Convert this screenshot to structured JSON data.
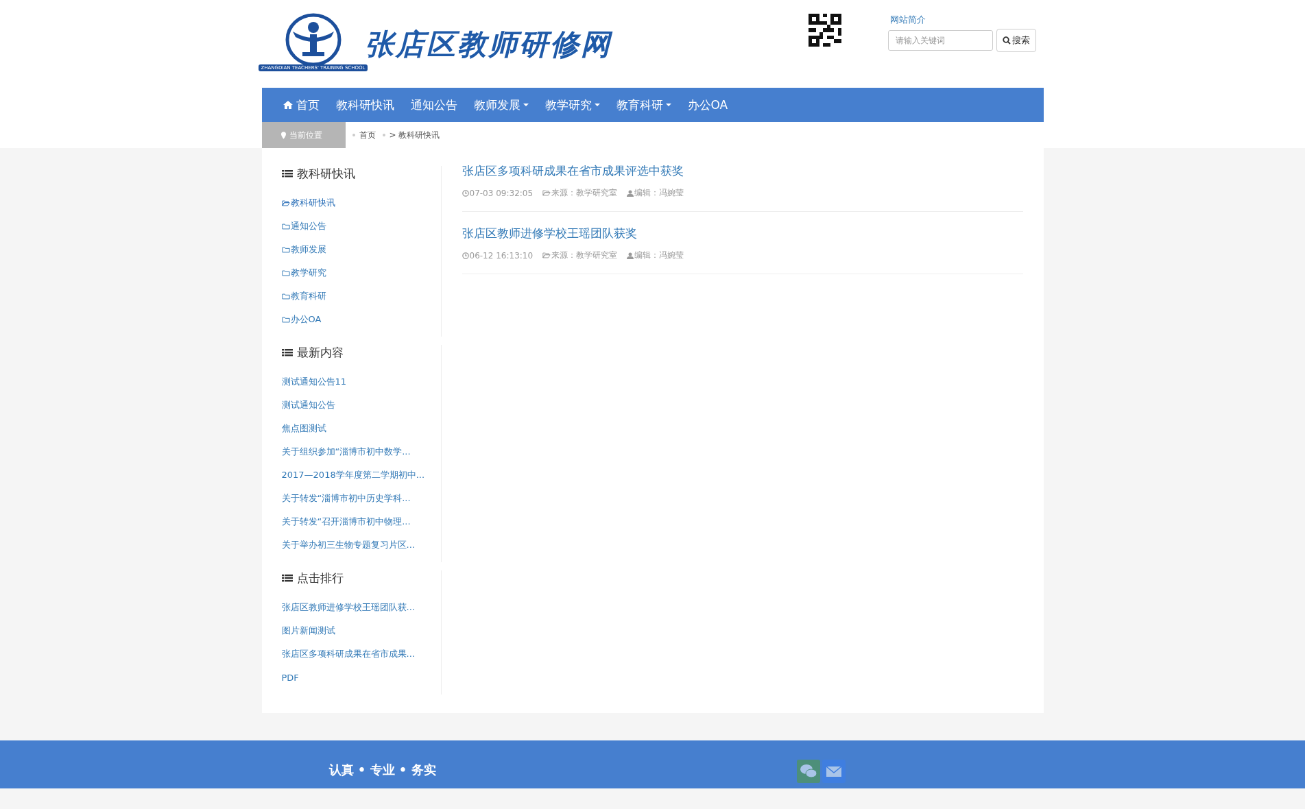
{
  "header": {
    "site_title": "张店区教师研修网",
    "emblem_caption": "ZHANGDIAN TEACHERS' TRAINING SCHOOL",
    "about_link": "网站简介",
    "search": {
      "placeholder": "请输入关键词",
      "button": "搜索"
    }
  },
  "nav": [
    {
      "label": "首页",
      "kind": "home",
      "dropdown": false
    },
    {
      "label": "教科研快讯",
      "kind": "link",
      "dropdown": false
    },
    {
      "label": "通知公告",
      "kind": "link",
      "dropdown": false
    },
    {
      "label": "教师发展",
      "kind": "link",
      "dropdown": true
    },
    {
      "label": "教学研究",
      "kind": "link",
      "dropdown": true
    },
    {
      "label": "教育科研",
      "kind": "link",
      "dropdown": true
    },
    {
      "label": "办公OA",
      "kind": "link",
      "dropdown": false
    }
  ],
  "breadcrumb": {
    "label": "当前位置",
    "items": [
      "首页",
      "> 教科研快讯"
    ]
  },
  "sidebar": [
    {
      "title": "教科研快讯",
      "kind": "category",
      "items": [
        {
          "label": "教科研快讯",
          "selected": true
        },
        {
          "label": "通知公告",
          "selected": false
        },
        {
          "label": "教师发展",
          "selected": false
        },
        {
          "label": "教学研究",
          "selected": false
        },
        {
          "label": "教育科研",
          "selected": false
        },
        {
          "label": "办公OA",
          "selected": false
        }
      ]
    },
    {
      "title": "最新内容",
      "kind": "list",
      "items": [
        {
          "label": "测试通知公告11"
        },
        {
          "label": "测试通知公告"
        },
        {
          "label": "焦点图测试"
        },
        {
          "label": "关于组织参加“淄博市初中数学..."
        },
        {
          "label": "2017—2018学年度第二学期初中..."
        },
        {
          "label": "关于转发“淄博市初中历史学科..."
        },
        {
          "label": "关于转发“召开淄博市初中物理..."
        },
        {
          "label": "关于举办初三生物专题复习片区..."
        }
      ]
    },
    {
      "title": "点击排行",
      "kind": "list",
      "items": [
        {
          "label": "张店区教师进修学校王瑶团队获..."
        },
        {
          "label": "图片新闻测试"
        },
        {
          "label": "张店区多项科研成果在省市成果..."
        },
        {
          "label": "PDF"
        }
      ]
    }
  ],
  "articles": [
    {
      "title": "张店区多项科研成果在省市成果评选中获奖",
      "time": "07-03 09:32:05",
      "source": "来源：教学研究室",
      "editor": "编辑：冯婉莹"
    },
    {
      "title": "张店区教师进修学校王瑶团队获奖",
      "time": "06-12 16:13:10",
      "source": "来源：教学研究室",
      "editor": "编辑：冯婉莹"
    }
  ],
  "footer": {
    "motto": "认真 • 专业 • 务实"
  }
}
